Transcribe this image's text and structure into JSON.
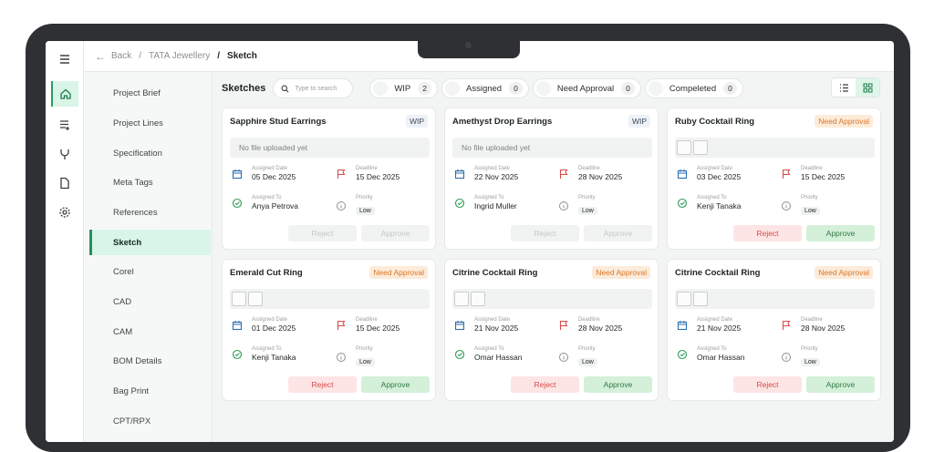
{
  "breadcrumb": {
    "back": "Back",
    "project": "TATA Jewellery",
    "current": "Sketch"
  },
  "menu": [
    "Project Brief",
    "Project Lines",
    "Specification",
    "Meta Tags",
    "References",
    "Sketch",
    "Corel",
    "CAD",
    "CAM",
    "BOM Details",
    "Bag Print",
    "CPT/RPX"
  ],
  "toolbar": {
    "title": "Sketches",
    "search_placeholder": "Type to search",
    "filters": [
      {
        "label": "WIP",
        "count": "2"
      },
      {
        "label": "Assigned",
        "count": "0"
      },
      {
        "label": "Need Approval",
        "count": "0"
      },
      {
        "label": "Compeleted",
        "count": "0"
      }
    ]
  },
  "labels": {
    "assigned_date": "Assigned Date",
    "deadline": "Deadline",
    "assigned_to": "Assigned To",
    "priority": "Priority",
    "reject": "Reject",
    "approve": "Approve",
    "no_file": "No file uploaded yet"
  },
  "cards": [
    {
      "title": "Sapphire Stud Earrings",
      "status": "WIP",
      "assigned_date": "05 Dec 2025",
      "deadline": "15 Dec 2025",
      "assigned_to": "Anya Petrova",
      "priority": "Low"
    },
    {
      "title": "Amethyst Drop Earrings",
      "status": "WIP",
      "assigned_date": "22 Nov 2025",
      "deadline": "28 Nov 2025",
      "assigned_to": "Ingrid Muller",
      "priority": "Low"
    },
    {
      "title": "Ruby Cocktail Ring",
      "status": "Need Approval",
      "assigned_date": "03 Dec 2025",
      "deadline": "15 Dec 2025",
      "assigned_to": "Kenji Tanaka",
      "priority": "Low"
    },
    {
      "title": "Emerald Cut Ring",
      "status": "Need Approval",
      "assigned_date": "01 Dec 2025",
      "deadline": "15 Dec 2025",
      "assigned_to": "Kenji Tanaka",
      "priority": "Low"
    },
    {
      "title": "Citrine Cocktail Ring",
      "status": "Need Approval",
      "assigned_date": "21 Nov 2025",
      "deadline": "28 Nov 2025",
      "assigned_to": "Omar Hassan",
      "priority": "Low"
    },
    {
      "title": "Citrine Cocktail Ring",
      "status": "Need Approval",
      "assigned_date": "21 Nov 2025",
      "deadline": "28 Nov 2025",
      "assigned_to": "Omar Hassan",
      "priority": "Low"
    }
  ]
}
